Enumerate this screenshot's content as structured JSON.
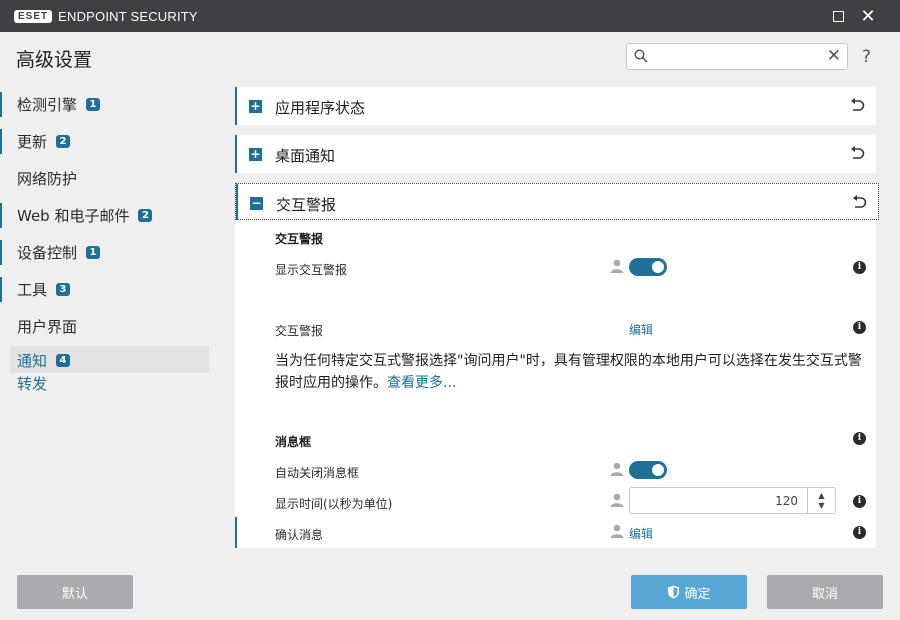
{
  "window": {
    "logo": "ESET",
    "product": "ENDPOINT SECURITY"
  },
  "header": {
    "title": "高级设置",
    "search_placeholder": "",
    "help": "?"
  },
  "sidebar": {
    "items": [
      {
        "label": "检测引擎",
        "badge": "1"
      },
      {
        "label": "更新",
        "badge": "2"
      },
      {
        "label": "网络防护",
        "badge": ""
      },
      {
        "label": "Web 和电子邮件",
        "badge": "2"
      },
      {
        "label": "设备控制",
        "badge": "1"
      },
      {
        "label": "工具",
        "badge": "3"
      },
      {
        "label": "用户界面",
        "badge": ""
      }
    ],
    "active_label": "通知",
    "active_badge": "4",
    "sub_label": "转发"
  },
  "sections": {
    "app_status": "应用程序状态",
    "desktop_notify": "桌面通知",
    "interactive_alerts": "交互警报"
  },
  "content": {
    "group1_title": "交互警报",
    "show_alerts_label": "显示交互警报",
    "alerts_label": "交互警报",
    "edit_label": "编辑",
    "description": "当为任何特定交互式警报选择\"询问用户\"时，具有管理权限的本地用户可以选择在发生交互式警报时应用的操作。",
    "see_more": "查看更多...",
    "group2_title": "消息框",
    "auto_close_label": "自动关闭消息框",
    "display_time_label": "显示时间(以秒为单位)",
    "display_time_value": "120",
    "confirm_label": "确认消息",
    "confirm_edit": "编辑"
  },
  "footer": {
    "default_label": "默认",
    "ok_label": "确定",
    "cancel_label": "取消"
  },
  "colors": {
    "accent": "#1f6f96",
    "titlebar": "#3f4044",
    "ok_button": "#59a7d6"
  }
}
